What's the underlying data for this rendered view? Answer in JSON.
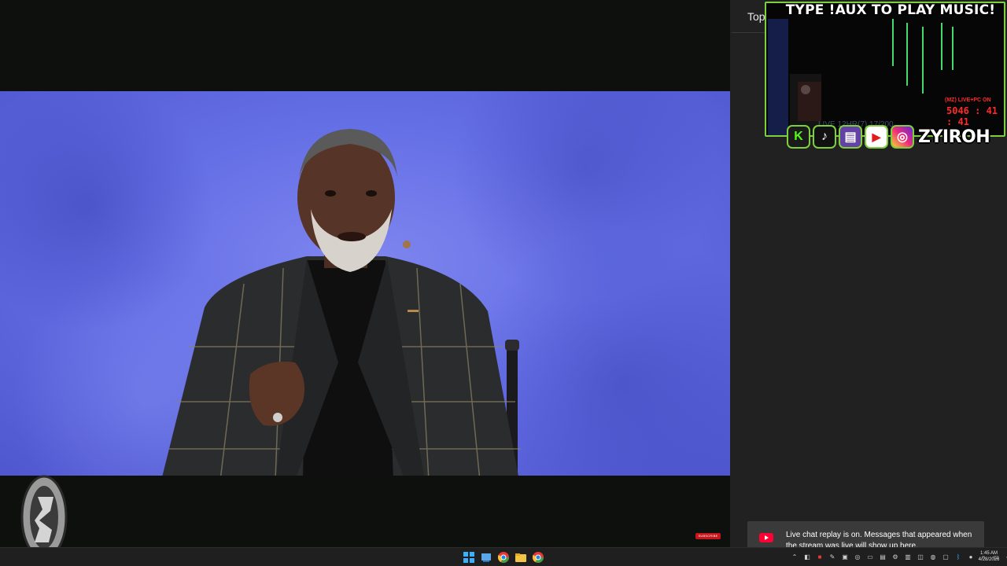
{
  "side_panel": {
    "top_chip_label": "Top"
  },
  "stream_overlay": {
    "banner_text": "TYPE !AUX TO PLAY MUSIC!",
    "timer_label": "(MZ) LIVE+PC ON",
    "timer_value": "5046 : 41 : 41",
    "faded_subtitle": "LIVE 12HR(7) 17/200",
    "handle": "ZYIROH",
    "accent_color": "#7ecf3d",
    "socials": [
      {
        "name": "kick",
        "glyph": "K"
      },
      {
        "name": "tiktok",
        "glyph": "♪"
      },
      {
        "name": "twitch",
        "glyph": "▤"
      },
      {
        "name": "youtube",
        "glyph": "▶"
      },
      {
        "name": "instagram",
        "glyph": "◎"
      }
    ]
  },
  "video": {
    "subscribe_badge": "SUBSCRIBE"
  },
  "chat": {
    "replay_notice": "Live chat replay is on. Messages that appeared when the stream was live will show up here."
  },
  "taskbar": {
    "pinned": [
      "windows-start-icon",
      "file-explorer-icon",
      "chrome-icon",
      "folder-icon",
      "chrome-icon"
    ],
    "time": "1:45 AM",
    "date": "4/28/2026"
  }
}
